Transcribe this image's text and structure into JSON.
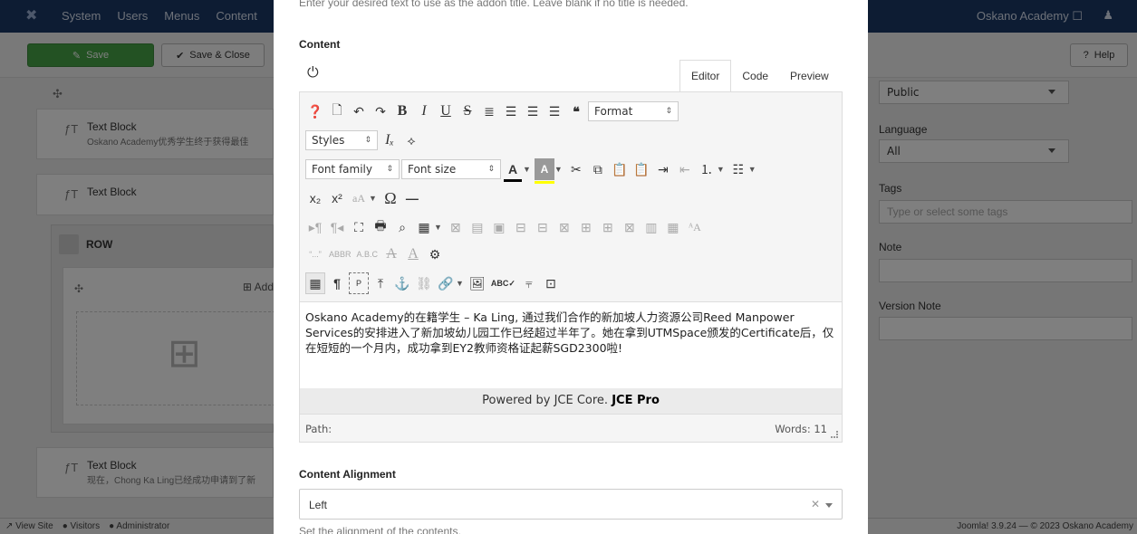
{
  "topbar": {
    "menu": [
      "System",
      "Users",
      "Menus",
      "Content"
    ],
    "site": "Oskano Academy ☐",
    "user": "♀"
  },
  "toolbar": {
    "save": "Save",
    "save_close": "Save & Close",
    "help": "Help"
  },
  "bg": {
    "block1_title": "Text Block",
    "block1_sub": "Oskano Academy优秀学生终于获得最佳",
    "block2_title": "Text Block",
    "row_label": "ROW",
    "add_element": "Add",
    "block3_title": "Text Block",
    "block3_sub": "现在，Chong Ka Ling已经成功申请到了新"
  },
  "side": {
    "access_value": "Public",
    "language_label": "Language",
    "language_value": "All",
    "tags_label": "Tags",
    "tags_placeholder": "Type or select some tags",
    "note_label": "Note",
    "version_label": "Version Note"
  },
  "statusbar": {
    "items": [
      "View Site",
      "Visitors",
      "Administrator"
    ],
    "right": "Joomla! 3.9.24 — © 2023 Oskano Academy"
  },
  "modal": {
    "help_top": "Enter your desired text to use as the addon title. Leave blank if no title is needed.",
    "content_label": "Content",
    "tabs": [
      "Editor",
      "Code",
      "Preview"
    ],
    "format": "Format",
    "styles": "Styles",
    "font_family": "Font family",
    "font_size": "Font size",
    "body_text": "Oskano Academy的在籍学生 – Ka Ling, 通过我们合作的新加坡人力资源公司Reed Manpower Services的安排进入了新加坡幼儿园工作已经超过半年了。她在拿到UTMSpace颁发的Certificate后，仅在短短的一个月内，成功拿到EY2教师资格证起薪SGD2300啦!",
    "powered_prefix": "Powered by JCE Core.",
    "powered_bold": "JCE Pro",
    "path_label": "Path:",
    "words": "Words: 11",
    "align_label": "Content Alignment",
    "align_value": "Left",
    "align_help": "Set the alignment of the contents."
  }
}
